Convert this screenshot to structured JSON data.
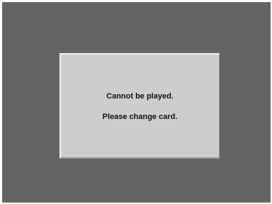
{
  "dialog": {
    "line1": "Cannot be played.",
    "line2": "Please change card."
  }
}
